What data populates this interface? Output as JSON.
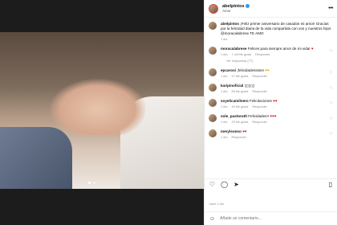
{
  "post": {
    "username": "abelpintos",
    "location": "Amor",
    "caption_user": "abelpintos",
    "caption_text": "¡Feliz primer aniversario de casados mi amor! Gracias por la felicidad diaria de la vida compartida con vos y nuestros hijos @moracalabrese TE AMO",
    "caption_time": "1 día"
  },
  "comments": [
    {
      "user": "moracalabrese",
      "text": "Felices para siempre amor de mi vida!",
      "time": "1 día",
      "likes": "7 mil Me gusta",
      "reply": "Responder",
      "replies": "Ver respuestas (77)"
    },
    {
      "user": "epcarosi",
      "text": "¡felicidadesssss!",
      "time": "1 día",
      "likes": "97 Me gusta",
      "reply": "Responder"
    },
    {
      "user": "karipinoficial",
      "text": "▯▯▯▯▯",
      "time": "1 día",
      "likes": "89 Me gusta",
      "reply": "Responder"
    },
    {
      "user": "soyelicamilnero",
      "text": "Felicitaciones",
      "time": "1 día",
      "likes": "45 Me gusta",
      "reply": "Responder"
    },
    {
      "user": "sole_pastorutti",
      "text": "Felicidades!!",
      "time": "1 día",
      "likes": "25 Me gusta",
      "reply": "Responder"
    },
    {
      "user": "merylsonso",
      "text": "",
      "time": "1 día",
      "likes": "",
      "reply": "Responder"
    }
  ],
  "engagement": {
    "date": "hace 1 día"
  },
  "composer": {
    "placeholder": "Añade un comentario..."
  },
  "icons": {
    "more": "more-icon",
    "heart": "heart-icon",
    "comment": "comment-icon",
    "share": "share-icon",
    "save": "save-icon",
    "emoji": "emoji-icon"
  }
}
